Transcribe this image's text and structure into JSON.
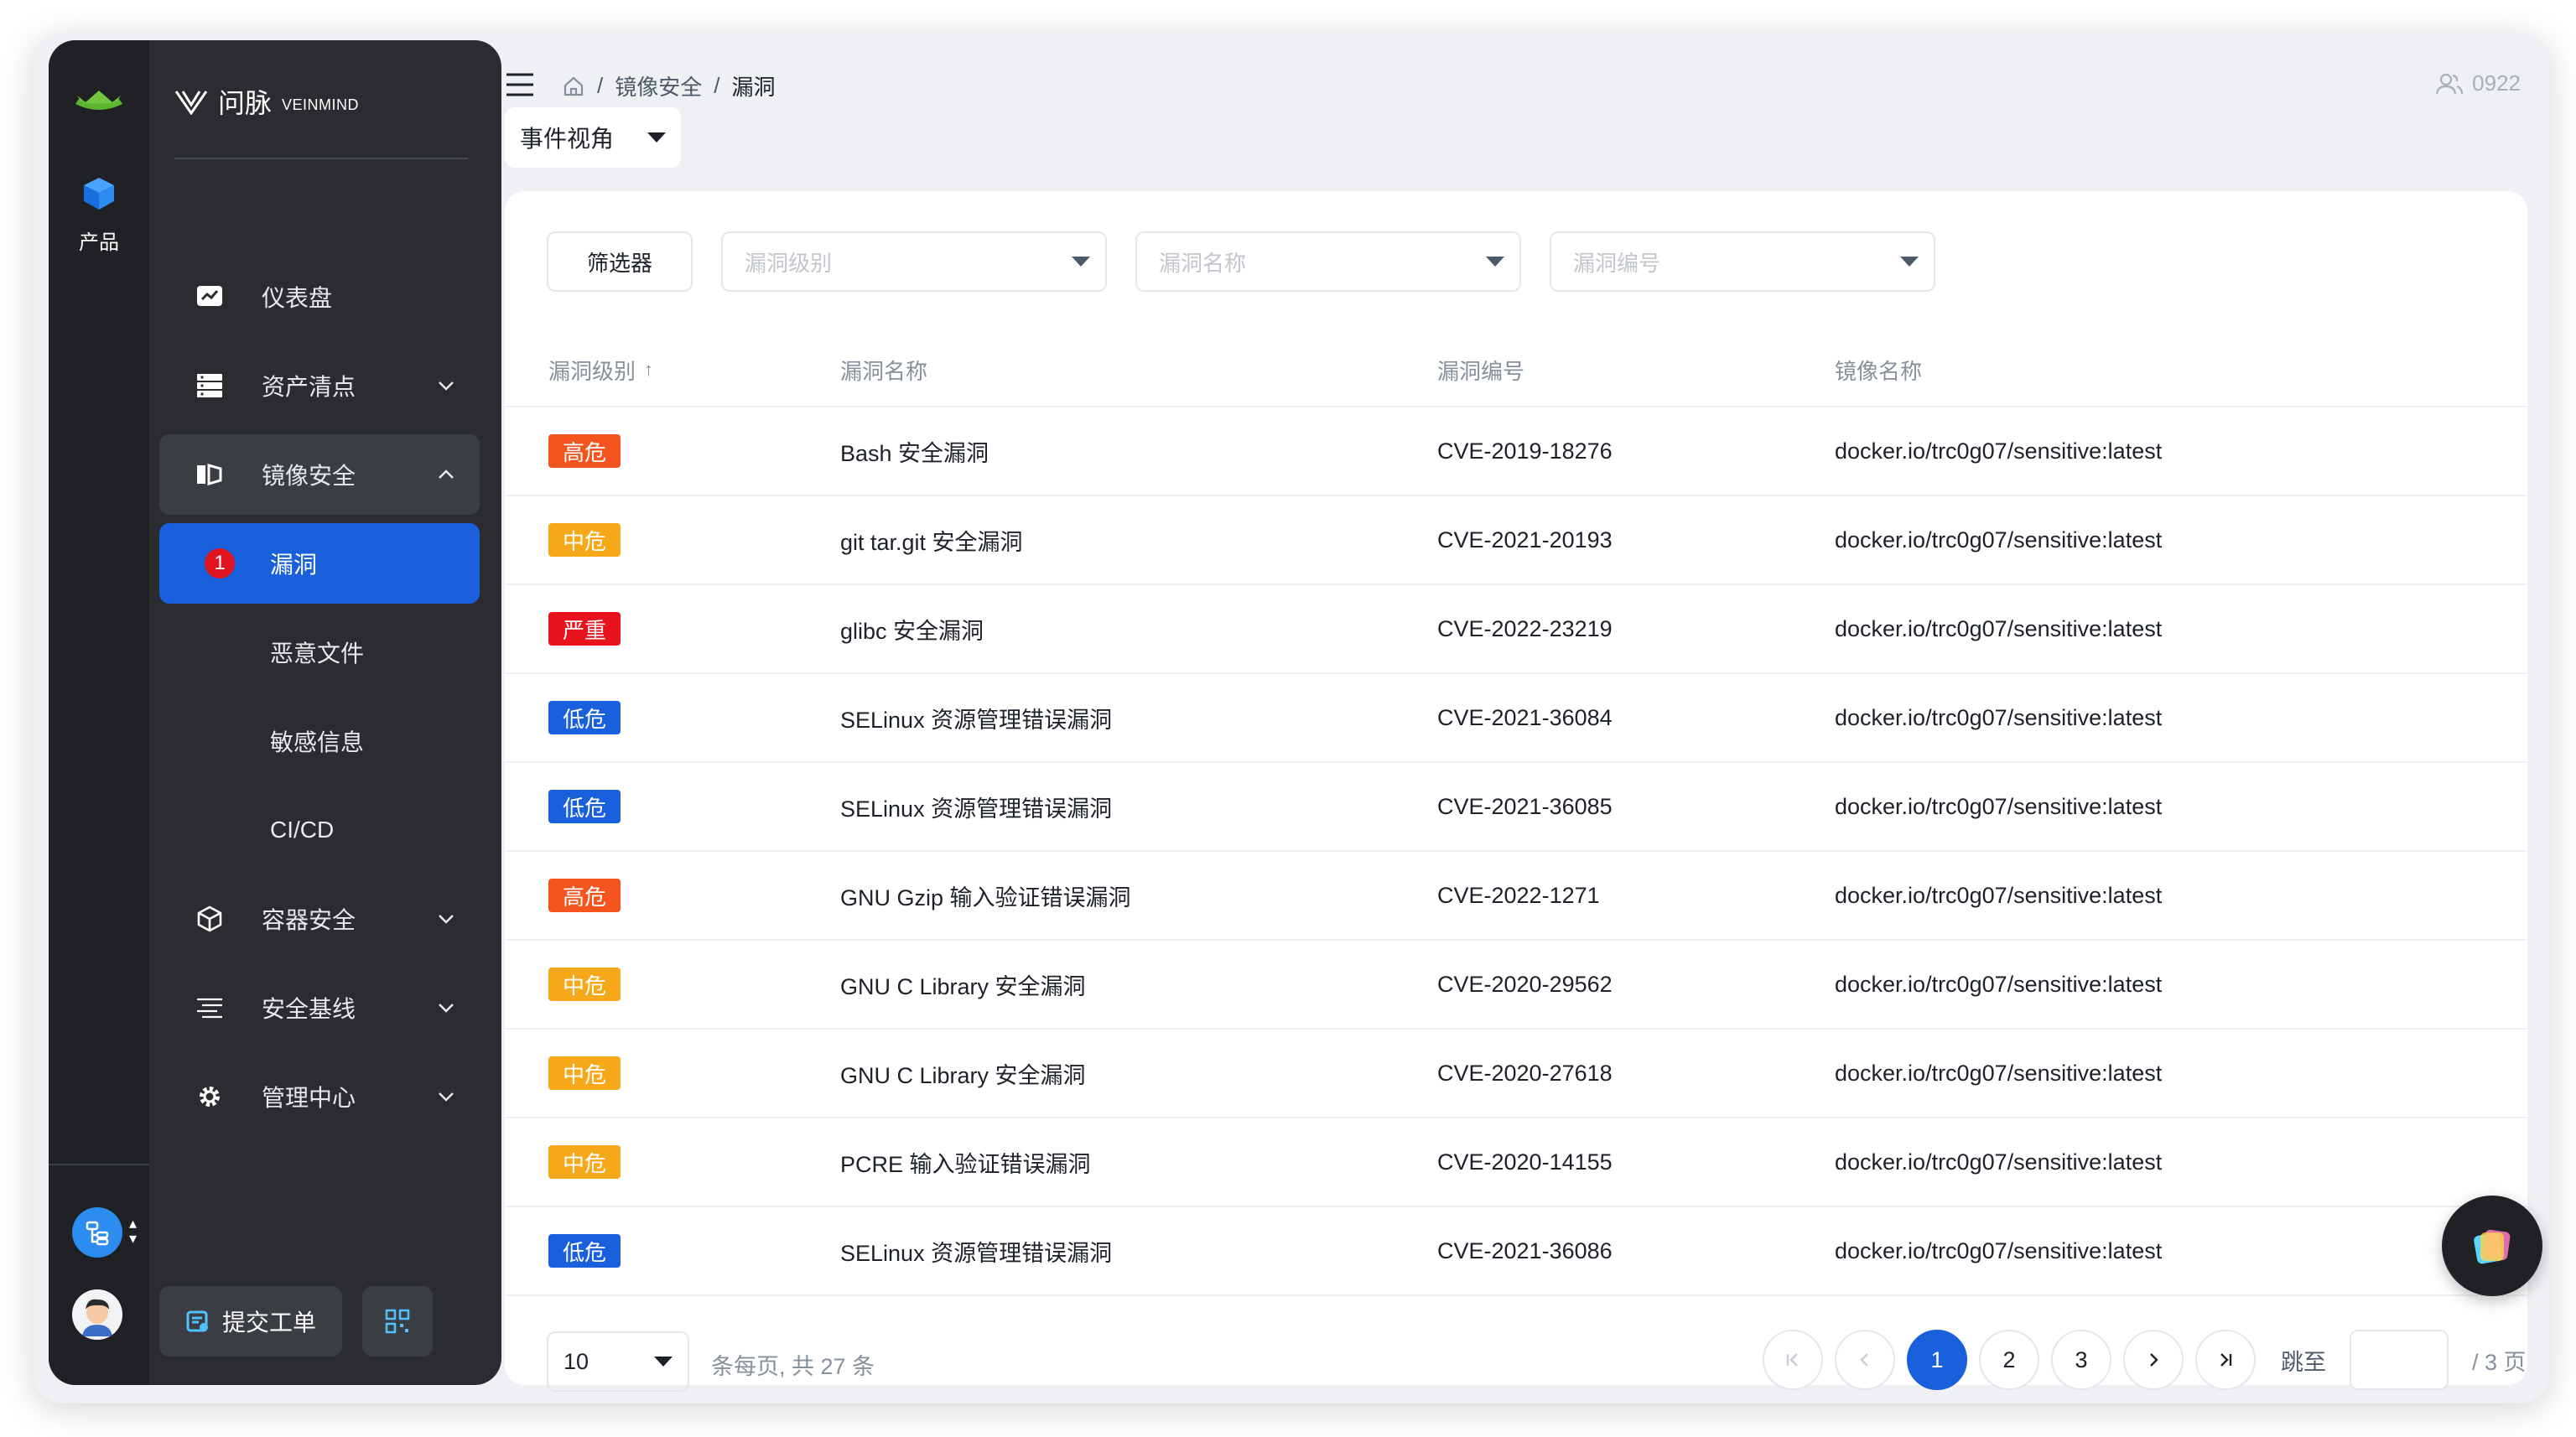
{
  "rail": {
    "product_label": "产品"
  },
  "brand": {
    "cn": "问脉",
    "en": "VEINMIND"
  },
  "nav": {
    "items": [
      {
        "label": "仪表盘"
      },
      {
        "label": "资产清点"
      },
      {
        "label": "镜像安全"
      },
      {
        "label": "容器安全"
      },
      {
        "label": "安全基线"
      },
      {
        "label": "管理中心"
      }
    ],
    "sub_items": [
      {
        "label": "漏洞",
        "badge": "1"
      },
      {
        "label": "恶意文件"
      },
      {
        "label": "敏感信息"
      },
      {
        "label": "CI/CD"
      }
    ],
    "ticket_label": "提交工单"
  },
  "header": {
    "breadcrumb": [
      "镜像安全",
      "漏洞"
    ],
    "user": "0922",
    "view_select": "事件视角"
  },
  "filters": {
    "button_label": "筛选器",
    "level_placeholder": "漏洞级别",
    "name_placeholder": "漏洞名称",
    "id_placeholder": "漏洞编号"
  },
  "table": {
    "headers": [
      "漏洞级别",
      "漏洞名称",
      "漏洞编号",
      "镜像名称"
    ],
    "sort_indicator": "↑",
    "rows": [
      {
        "level": "高危",
        "name": "Bash 安全漏洞",
        "cve": "CVE-2019-18276",
        "image": "docker.io/trc0g07/sensitive:latest"
      },
      {
        "level": "中危",
        "name": "git tar.git 安全漏洞",
        "cve": "CVE-2021-20193",
        "image": "docker.io/trc0g07/sensitive:latest"
      },
      {
        "level": "严重",
        "name": "glibc 安全漏洞",
        "cve": "CVE-2022-23219",
        "image": "docker.io/trc0g07/sensitive:latest"
      },
      {
        "level": "低危",
        "name": "SELinux 资源管理错误漏洞",
        "cve": "CVE-2021-36084",
        "image": "docker.io/trc0g07/sensitive:latest"
      },
      {
        "level": "低危",
        "name": "SELinux 资源管理错误漏洞",
        "cve": "CVE-2021-36085",
        "image": "docker.io/trc0g07/sensitive:latest"
      },
      {
        "level": "高危",
        "name": "GNU Gzip 输入验证错误漏洞",
        "cve": "CVE-2022-1271",
        "image": "docker.io/trc0g07/sensitive:latest"
      },
      {
        "level": "中危",
        "name": "GNU C Library 安全漏洞",
        "cve": "CVE-2020-29562",
        "image": "docker.io/trc0g07/sensitive:latest"
      },
      {
        "level": "中危",
        "name": "GNU C Library 安全漏洞",
        "cve": "CVE-2020-27618",
        "image": "docker.io/trc0g07/sensitive:latest"
      },
      {
        "level": "中危",
        "name": "PCRE 输入验证错误漏洞",
        "cve": "CVE-2020-14155",
        "image": "docker.io/trc0g07/sensitive:latest"
      },
      {
        "level": "低危",
        "name": "SELinux 资源管理错误漏洞",
        "cve": "CVE-2021-36086",
        "image": "docker.io/trc0g07/sensitive:latest"
      }
    ]
  },
  "severity_colors": {
    "严重": "#e8131c",
    "高危": "#f5541e",
    "中危": "#f7a818",
    "低危": "#1a5fdc"
  },
  "pagination": {
    "page_size": "10",
    "info": "条每页, 共 27 条",
    "pages": [
      "1",
      "2",
      "3"
    ],
    "current": "1",
    "jump_label": "跳至",
    "total_label": "/ 3 页"
  },
  "colors": {
    "accent": "#1a5fdc",
    "sidebar_bg": "#2a2c30"
  }
}
